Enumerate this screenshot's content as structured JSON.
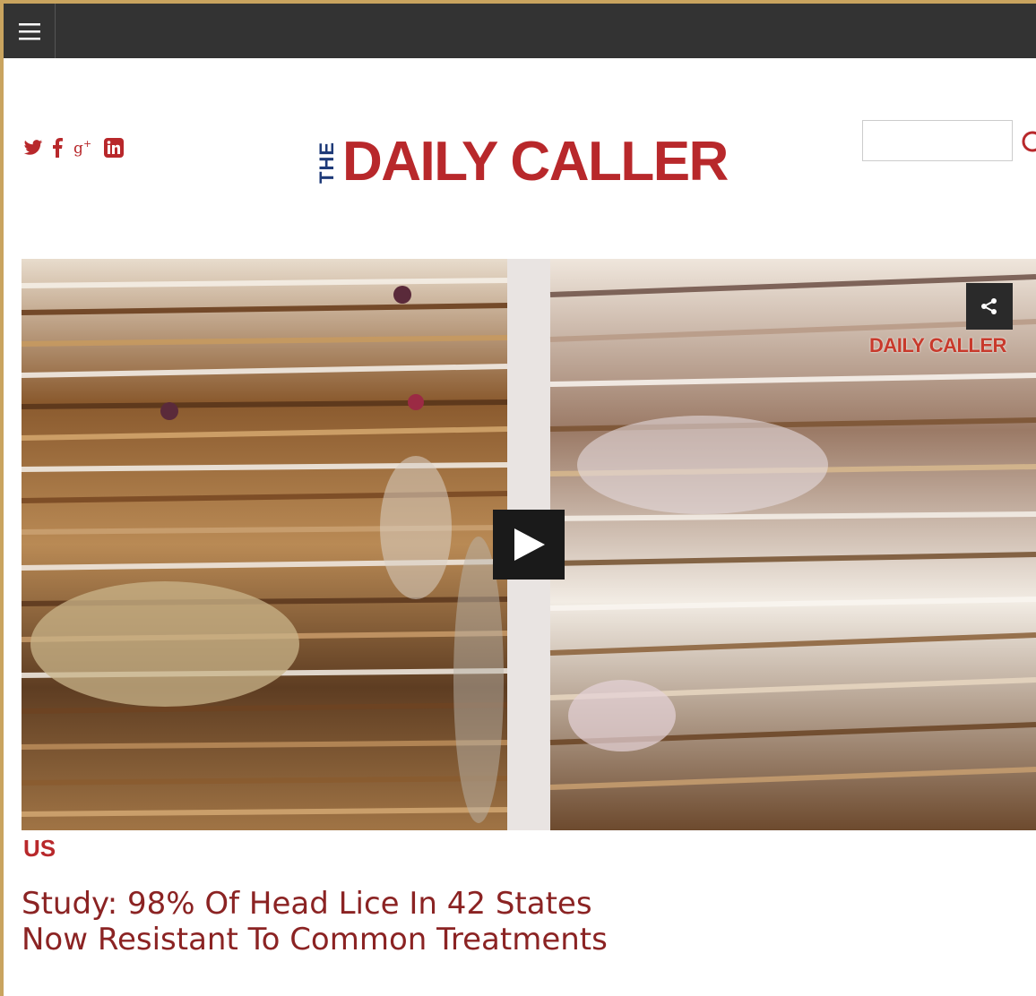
{
  "navbar": {
    "menu_icon": "hamburger-menu-icon"
  },
  "header": {
    "social_icons": [
      "twitter-icon",
      "facebook-icon",
      "google-plus-icon",
      "linkedin-icon"
    ],
    "logo": {
      "the": "THE",
      "name": "DAILY CALLER"
    },
    "search": {
      "value": "",
      "placeholder": ""
    },
    "search_icon": "search-icon"
  },
  "video": {
    "watermark": "DAILY CALLER",
    "play_icon": "play-icon",
    "share_icon": "share-icon"
  },
  "article": {
    "category": "US",
    "headline": "Study: 98% Of Head Lice In 42 States Now Resistant To Common Treatments"
  },
  "colors": {
    "brand_red": "#b8282b",
    "brand_blue": "#1e3a78",
    "navbar": "#333333",
    "page_border": "#c9a45f"
  }
}
